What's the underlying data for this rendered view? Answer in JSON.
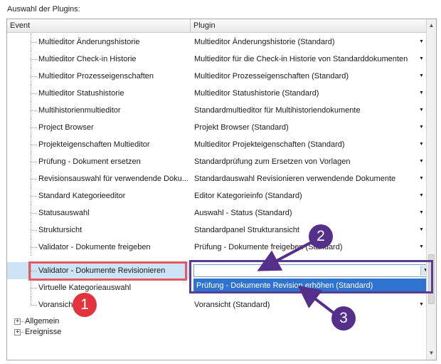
{
  "section_title": "Auswahl der Plugins:",
  "grid": {
    "columns": {
      "event": "Event",
      "plugin": "Plugin"
    },
    "rows": [
      {
        "event": "Multieditor Änderungshistorie",
        "plugin": "Multieditor Änderungshistorie (Standard)"
      },
      {
        "event": "Multieditor Check-in Historie",
        "plugin": "Multieditor für die Check-in Historie von Standarddokumenten"
      },
      {
        "event": "Multieditor Prozesseigenschaften",
        "plugin": "Multieditor Prozesseigenschaften (Standard)"
      },
      {
        "event": "Multieditor Statushistorie",
        "plugin": "Multieditor Statushistorie (Standard)"
      },
      {
        "event": "Multihistorienmultieditor",
        "plugin": "Standardmultieditor für Multihistoriendokumente"
      },
      {
        "event": "Project Browser",
        "plugin": "Projekt Browser (Standard)"
      },
      {
        "event": "Projekteigenschaften Multieditor",
        "plugin": "Multieditor Projekteigenschaften (Standard)"
      },
      {
        "event": "Prüfung  -  Dokument ersetzen",
        "plugin": "Standardprüfung zum Ersetzen von Vorlagen"
      },
      {
        "event": "Revisionsauswahl für verwendende Doku...",
        "plugin": "Standardauswahl Revisionieren verwendende Dokumente"
      },
      {
        "event": "Standard Kategorieeditor",
        "plugin": "Editor Kategorieinfo (Standard)"
      },
      {
        "event": "Statusauswahl",
        "plugin": "Auswahl - Status (Standard)"
      },
      {
        "event": "Struktursicht",
        "plugin": "Standardpanel Strukturansicht"
      },
      {
        "event": "Validator - Dokumente freigeben",
        "plugin": "Prüfung - Dokumente freigeben (Standard)"
      }
    ],
    "selected_row": {
      "event": "Validator - Dokumente Revisionieren",
      "editor_value": "",
      "dropdown_option": "Prüfung - Dokumente Revision erhöhen (Standard)"
    },
    "after_rows": [
      {
        "event": "Virtuelle Kategorieauswahl",
        "plugin": ""
      },
      {
        "event": "Voransicht",
        "plugin": "Voransicht (Standard)"
      }
    ],
    "groups": [
      {
        "expander": "+",
        "label": "Allgemein"
      },
      {
        "expander": "+",
        "label": "Ereignisse"
      }
    ]
  },
  "annotations": {
    "badge_1": "1",
    "badge_2": "2",
    "badge_3": "3",
    "highlight_color": "#e4595f",
    "accent_color": "#55308a"
  },
  "icons": {
    "dropdown": "▼",
    "scroll_up": "▲",
    "scroll_down": "▼"
  }
}
